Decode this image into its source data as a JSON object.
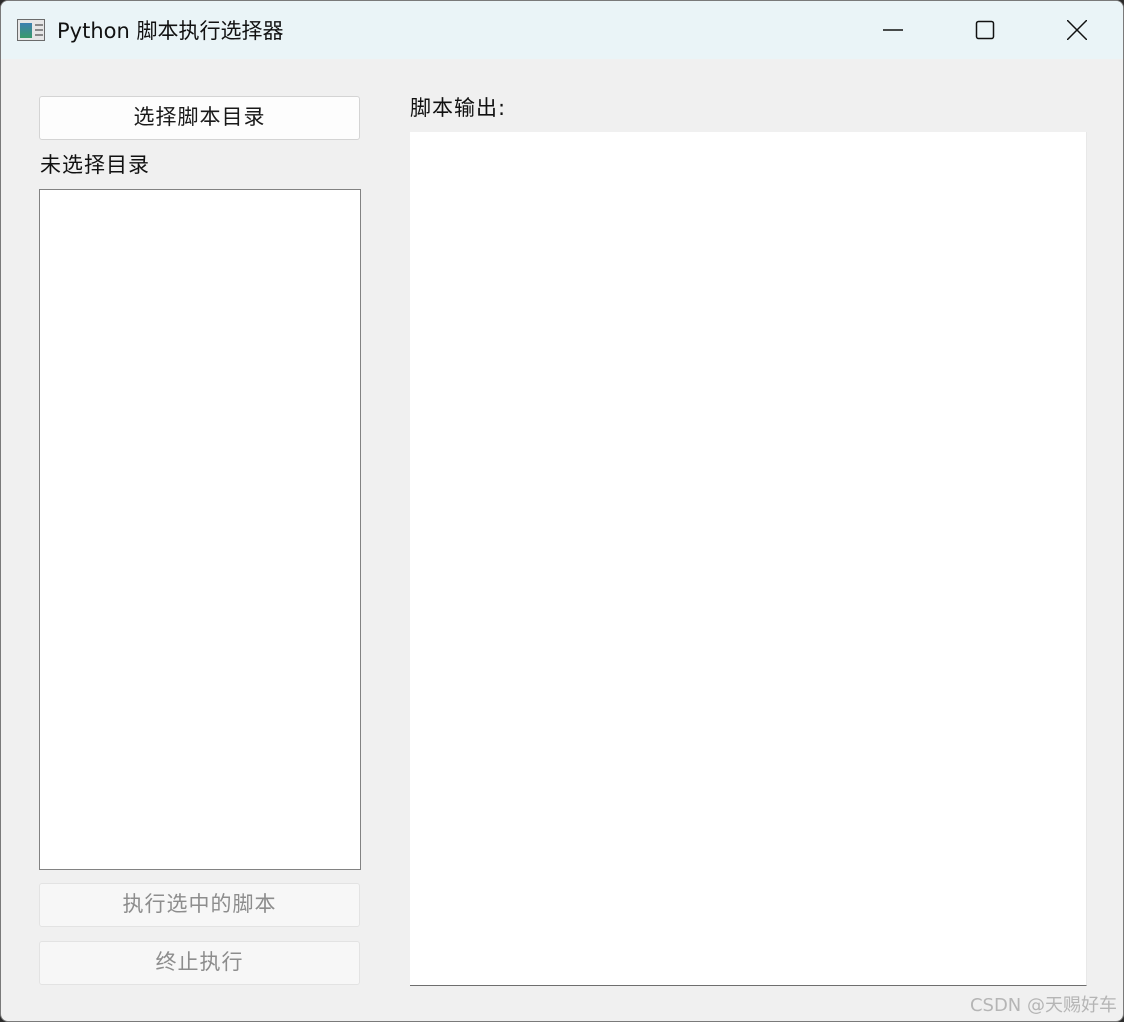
{
  "window": {
    "title": "Python 脚本执行选择器",
    "icon": "python-app-icon",
    "controls": [
      "minimize-icon",
      "maximize-icon",
      "close-icon"
    ]
  },
  "left_panel": {
    "select_dir_button": "选择脚本目录",
    "dir_status": "未选择目录",
    "script_list": [],
    "run_button": "执行选中的脚本",
    "stop_button": "终止执行",
    "run_button_enabled": false,
    "stop_button_enabled": false
  },
  "right_panel": {
    "output_label": "脚本输出:",
    "output_text": ""
  },
  "watermark": "CSDN @天赐好车"
}
